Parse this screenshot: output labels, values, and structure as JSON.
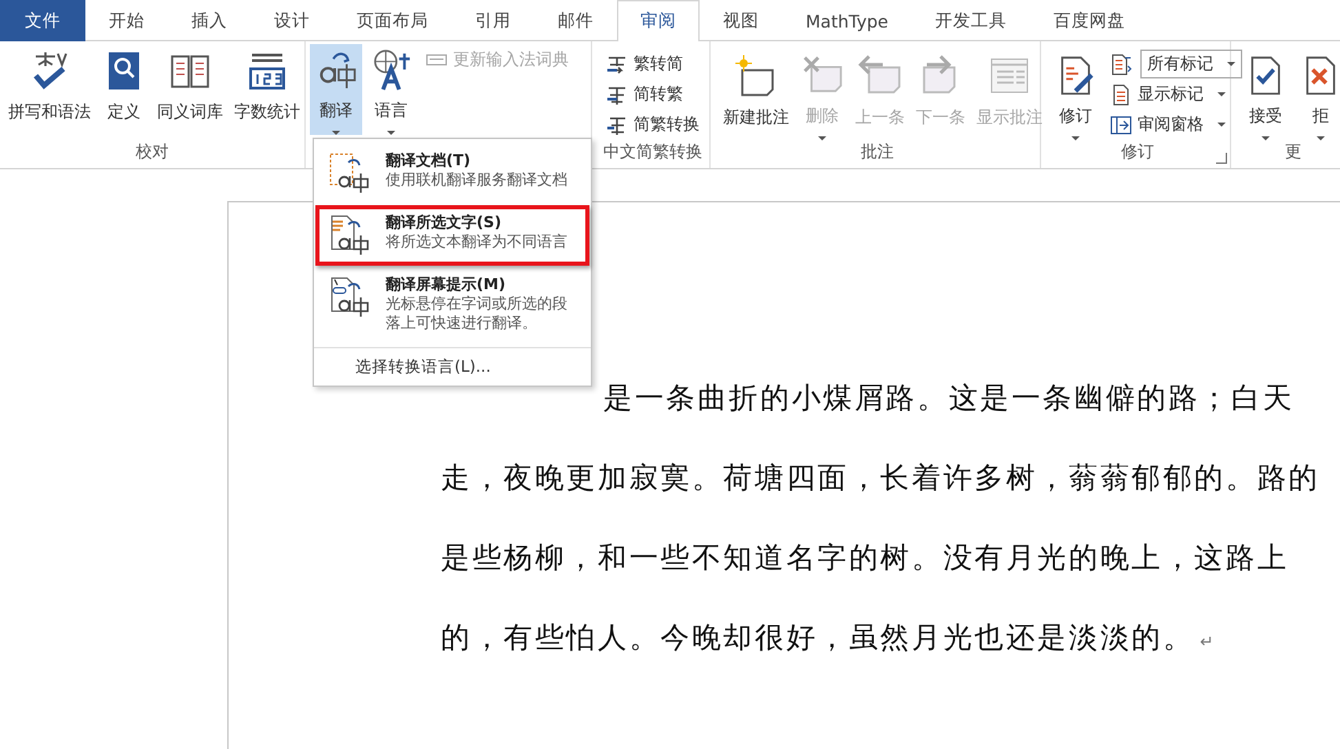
{
  "tabs": [
    {
      "label": "文件",
      "kind": "file",
      "selected": false
    },
    {
      "label": "开始",
      "kind": "tab",
      "selected": false
    },
    {
      "label": "插入",
      "kind": "tab",
      "selected": false
    },
    {
      "label": "设计",
      "kind": "tab",
      "selected": false
    },
    {
      "label": "页面布局",
      "kind": "tab",
      "selected": false
    },
    {
      "label": "引用",
      "kind": "tab",
      "selected": false
    },
    {
      "label": "邮件",
      "kind": "tab",
      "selected": false
    },
    {
      "label": "审阅",
      "kind": "tab",
      "selected": true
    },
    {
      "label": "视图",
      "kind": "tab",
      "selected": false
    },
    {
      "label": "MathType",
      "kind": "tab",
      "selected": false
    },
    {
      "label": "开发工具",
      "kind": "tab",
      "selected": false
    },
    {
      "label": "百度网盘",
      "kind": "tab",
      "selected": false
    }
  ],
  "ribbon": {
    "groups": [
      {
        "label": "校对",
        "columns": [
          [
            {
              "kind": "large",
              "label": "拼写和语法",
              "disabled": false,
              "caret": false,
              "expanded": false
            }
          ],
          [
            {
              "kind": "large",
              "label": "定义",
              "disabled": false,
              "caret": false,
              "expanded": false
            }
          ],
          [
            {
              "kind": "large",
              "label": "同义词库",
              "disabled": false,
              "caret": false,
              "expanded": false
            }
          ],
          [
            {
              "kind": "large",
              "label": "字数统计",
              "disabled": false,
              "caret": false,
              "expanded": false
            }
          ]
        ]
      },
      {
        "columns": [
          [
            {
              "kind": "large",
              "label": "翻译",
              "disabled": false,
              "caret": true,
              "expanded": true
            }
          ],
          [
            {
              "kind": "large",
              "label": "语言",
              "disabled": false,
              "caret": true,
              "expanded": false
            }
          ],
          [
            {
              "kind": "small",
              "label": "更新输入法词典",
              "disabled": true,
              "caret": false,
              "expanded": false
            }
          ]
        ]
      },
      {
        "label": "中文简繁转换",
        "columns": [
          [
            {
              "kind": "small",
              "label": "繁转简",
              "disabled": false,
              "caret": false,
              "expanded": false
            },
            {
              "kind": "small",
              "label": "简转繁",
              "disabled": false,
              "caret": false,
              "expanded": false
            },
            {
              "kind": "small",
              "label": "简繁转换",
              "disabled": false,
              "caret": false,
              "expanded": false
            }
          ]
        ]
      },
      {
        "label": "批注",
        "columns": [
          [
            {
              "kind": "large",
              "label": "新建批注",
              "disabled": false,
              "caret": false,
              "expanded": false
            }
          ],
          [
            {
              "kind": "large",
              "label": "删除",
              "disabled": true,
              "caret": true,
              "expanded": false
            }
          ],
          [
            {
              "kind": "large",
              "label": "上一条",
              "disabled": true,
              "caret": false,
              "expanded": false
            }
          ],
          [
            {
              "kind": "large",
              "label": "下一条",
              "disabled": true,
              "caret": false,
              "expanded": false
            }
          ],
          [
            {
              "kind": "large",
              "label": "显示批注",
              "disabled": true,
              "caret": false,
              "expanded": false
            }
          ]
        ]
      },
      {
        "label": "修订",
        "launcher": true,
        "columns": [
          [
            {
              "kind": "large",
              "label": "修订",
              "disabled": false,
              "caret": true,
              "expanded": false
            }
          ],
          [
            {
              "kind": "select",
              "label": "所有标记",
              "disabled": false,
              "caret": true,
              "expanded": false
            },
            {
              "kind": "small",
              "label": "显示标记",
              "disabled": false,
              "caret": true,
              "expanded": false
            },
            {
              "kind": "small",
              "label": "审阅窗格",
              "disabled": false,
              "caret": true,
              "expanded": false
            }
          ]
        ]
      },
      {
        "label": "更",
        "columns": [
          [
            {
              "kind": "large",
              "label": "接受",
              "disabled": false,
              "caret": true,
              "expanded": false
            }
          ],
          [
            {
              "kind": "large",
              "label": "拒",
              "disabled": false,
              "caret": true,
              "expanded": false
            }
          ]
        ]
      }
    ]
  },
  "menu": {
    "items": [
      {
        "title": "翻译文档(T)",
        "description": "使用联机翻译服务翻译文档",
        "annotated": false
      },
      {
        "title": "翻译所选文字(S)",
        "description": "将所选文本翻译为不同语言",
        "annotated": true
      },
      {
        "title": "翻译屏幕提示(M)",
        "description": "光标悬停在字词或所选的段落上可快速进行翻译。",
        "annotated": false
      }
    ],
    "footer": "选择转换语言(L)..."
  },
  "document": {
    "lines": [
      "是一条曲折的小煤屑路。这是一条幽僻的路；白天",
      "走，夜晚更加寂寞。荷塘四面，长着许多树，蓊蓊郁郁的。路的",
      "是些杨柳，和一些不知道名字的树。没有月光的晚上，这路上",
      "的，有些怕人。今晚却很好，虽然月光也还是淡淡的。"
    ],
    "paragraph_mark": "↵"
  }
}
